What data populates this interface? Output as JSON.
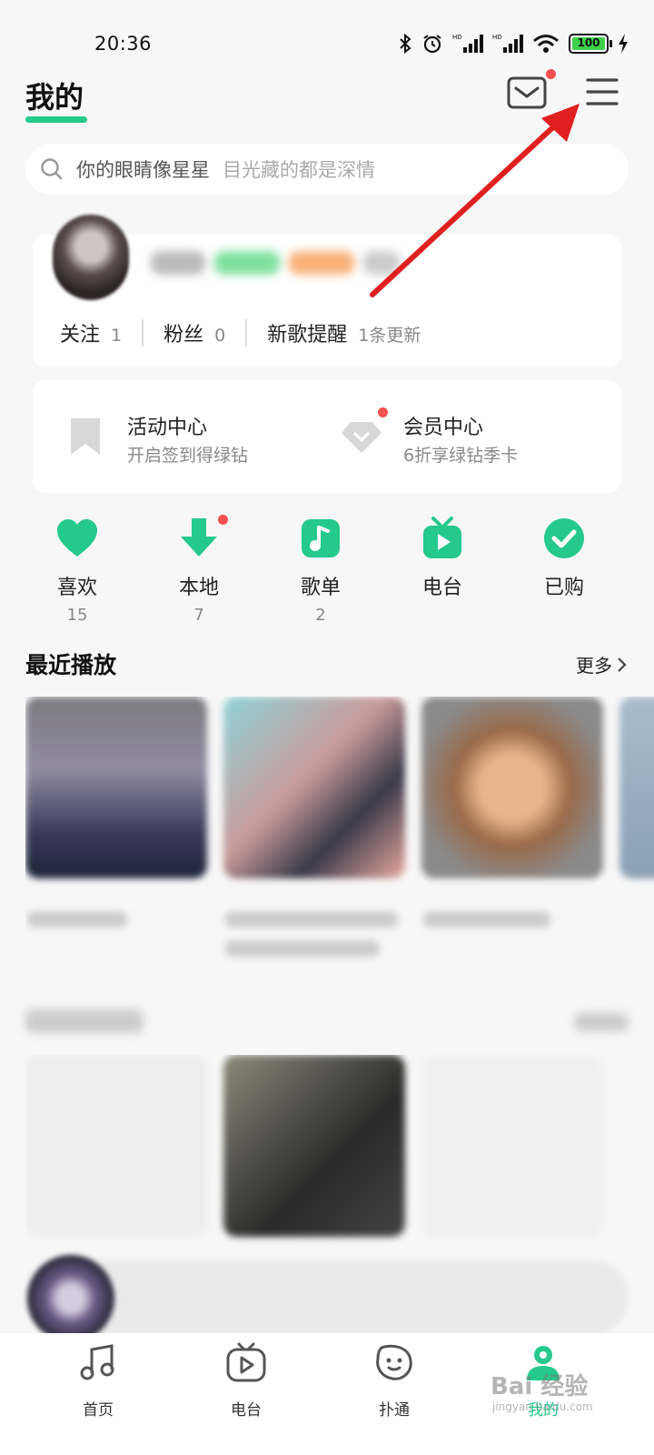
{
  "status_bar": {
    "time": "20:36",
    "battery": "100"
  },
  "header": {
    "title": "我的"
  },
  "search": {
    "text": "你的眼睛像星星",
    "hint": "目光藏的都是深情"
  },
  "profile": {
    "stats": [
      {
        "label": "关注",
        "value": "1"
      },
      {
        "label": "粉丝",
        "value": "0"
      },
      {
        "label": "新歌提醒",
        "value": "1条更新"
      }
    ]
  },
  "promos": [
    {
      "title": "活动中心",
      "subtitle": "开启签到得绿钻"
    },
    {
      "title": "会员中心",
      "subtitle": "6折享绿钻季卡"
    }
  ],
  "quick_access": [
    {
      "label": "喜欢",
      "count": "15",
      "icon": "heart-icon"
    },
    {
      "label": "本地",
      "count": "7",
      "icon": "download-icon"
    },
    {
      "label": "歌单",
      "count": "2",
      "icon": "playlist-icon"
    },
    {
      "label": "电台",
      "count": "",
      "icon": "radio-icon"
    },
    {
      "label": "已购",
      "count": "",
      "icon": "purchased-icon"
    }
  ],
  "recent": {
    "title": "最近播放",
    "more": "更多"
  },
  "tabs": [
    {
      "label": "首页",
      "icon": "music-note-icon"
    },
    {
      "label": "电台",
      "icon": "tv-play-icon"
    },
    {
      "label": "扑通",
      "icon": "face-icon"
    },
    {
      "label": "我的",
      "icon": "profile-icon",
      "active": true
    }
  ],
  "watermark": {
    "text": "Bai 经验",
    "sub": "jingyan.baidu.com"
  },
  "colors": {
    "accent": "#25c98c",
    "badge": "#f55050",
    "arrow": "#e02020"
  }
}
